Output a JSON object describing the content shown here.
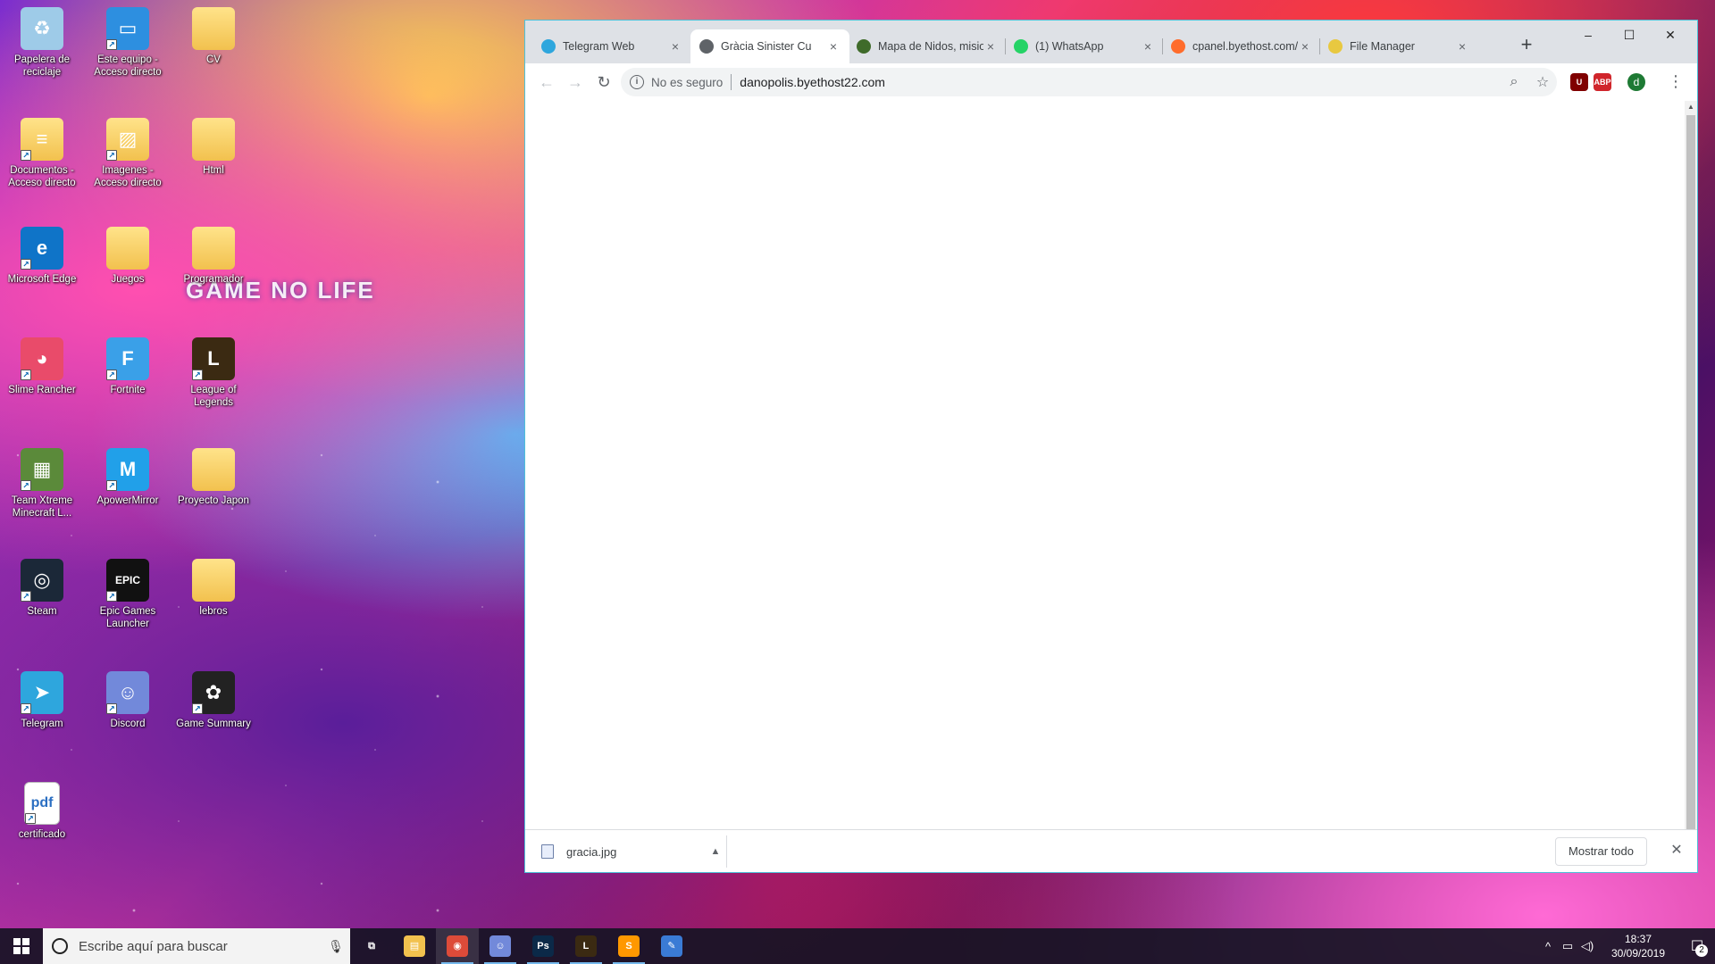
{
  "wallpaper": {
    "title_text": "GAME NO LIFE"
  },
  "desktop_icons": [
    {
      "label": "Papelera de reciclaje",
      "icon": "recycle-bin-icon",
      "glyph": "♻",
      "color": "#9ecbe8"
    },
    {
      "label": "Este equipo - Acceso directo",
      "icon": "computer-icon",
      "glyph": "▭",
      "color": "#2d8fe0"
    },
    {
      "label": "CV",
      "icon": "folder-icon",
      "glyph": "",
      "color": "#f2c14e"
    },
    {
      "label": "Documentos - Acceso directo",
      "icon": "documents-icon",
      "glyph": "≡",
      "color": "#f2c14e"
    },
    {
      "label": "Imagenes - Acceso directo",
      "icon": "pictures-icon",
      "glyph": "▨",
      "color": "#f2c14e"
    },
    {
      "label": "Html",
      "icon": "folder-icon",
      "glyph": "",
      "color": "#f2c14e"
    },
    {
      "label": "Microsoft Edge",
      "icon": "edge-icon",
      "glyph": "e",
      "color": "#0f74c8"
    },
    {
      "label": "Juegos",
      "icon": "folder-icon",
      "glyph": "",
      "color": "#f2c14e"
    },
    {
      "label": "Programador",
      "icon": "folder-icon",
      "glyph": "",
      "color": "#f2c14e"
    },
    {
      "label": "Slime Rancher",
      "icon": "slime-rancher-icon",
      "glyph": "◕",
      "color": "#e94b6a"
    },
    {
      "label": "Fortnite",
      "icon": "fortnite-icon",
      "glyph": "F",
      "color": "#3aa0e8"
    },
    {
      "label": "League of Legends",
      "icon": "league-of-legends-icon",
      "glyph": "L",
      "color": "#3b2a12"
    },
    {
      "label": "Team Xtreme Minecraft L...",
      "icon": "minecraft-icon",
      "glyph": "▦",
      "color": "#5b8a3a"
    },
    {
      "label": "ApowerMirror",
      "icon": "apowermirror-icon",
      "glyph": "M",
      "color": "#21a0e9"
    },
    {
      "label": "Proyecto Japon",
      "icon": "folder-icon",
      "glyph": "",
      "color": "#f2c14e"
    },
    {
      "label": "Steam",
      "icon": "steam-icon",
      "glyph": "◎",
      "color": "#1b2838"
    },
    {
      "label": "Epic Games Launcher",
      "icon": "epic-games-icon",
      "glyph": "EPIC",
      "color": "#111111"
    },
    {
      "label": "lebros",
      "icon": "folder-icon",
      "glyph": "",
      "color": "#f2c14e"
    },
    {
      "label": "Telegram",
      "icon": "telegram-icon",
      "glyph": "➤",
      "color": "#2ea6dd"
    },
    {
      "label": "Discord",
      "icon": "discord-icon",
      "glyph": "☺",
      "color": "#7289da"
    },
    {
      "label": "Game Summary",
      "icon": "game-summary-icon",
      "glyph": "✿",
      "color": "#222222"
    },
    {
      "label": "certificado",
      "icon": "pdf-icon",
      "glyph": "pdf",
      "color": "#ffffff"
    }
  ],
  "browser": {
    "tabs": [
      {
        "title": "Telegram Web",
        "icon": "telegram-tab-icon",
        "color": "#2ea6dd",
        "active": false
      },
      {
        "title": "Gràcia Sinister Cu",
        "icon": "globe-tab-icon",
        "color": "#5f6368",
        "active": true
      },
      {
        "title": "Mapa de Nidos, misio",
        "icon": "map-tab-icon",
        "color": "#3f6b2a",
        "active": false
      },
      {
        "title": "(1) WhatsApp",
        "icon": "whatsapp-tab-icon",
        "color": "#25d366",
        "active": false
      },
      {
        "title": "cpanel.byethost.com/",
        "icon": "cpanel-tab-icon",
        "color": "#ff6c2c",
        "active": false
      },
      {
        "title": "File Manager",
        "icon": "file-manager-tab-icon",
        "color": "#e8c840",
        "active": false
      }
    ],
    "new_tab": "+",
    "window_controls": {
      "minimize": "–",
      "maximize": "☐",
      "close": "✕"
    },
    "omnibox": {
      "security_label": "No es seguro",
      "url": "danopolis.byethost22.com"
    },
    "extensions": [
      {
        "name": "ublock",
        "label": "U",
        "color": "#800000"
      },
      {
        "name": "adblock-plus",
        "label": "ABP",
        "color": "#d0252b"
      }
    ],
    "profile_initial": "d",
    "download": {
      "file_name": "gracia.jpg",
      "show_all": "Mostrar todo"
    }
  },
  "taskbar": {
    "search_placeholder": "Escribe aquí para buscar",
    "apps": [
      {
        "name": "task-view",
        "glyph": "⧉",
        "color": "transparent"
      },
      {
        "name": "file-explorer",
        "glyph": "▤",
        "color": "#f2c14e"
      },
      {
        "name": "chrome",
        "glyph": "◉",
        "color": "#dd4b39"
      },
      {
        "name": "discord",
        "glyph": "☺",
        "color": "#7289da"
      },
      {
        "name": "photoshop",
        "glyph": "Ps",
        "color": "#0b2948"
      },
      {
        "name": "league-of-legends",
        "glyph": "L",
        "color": "#3b2a12"
      },
      {
        "name": "sublime-text",
        "glyph": "S",
        "color": "#ff9800"
      },
      {
        "name": "paint",
        "glyph": "✎",
        "color": "#3a7bd5"
      }
    ],
    "time": "18:37",
    "date": "30/09/2019",
    "notification_count": "2"
  }
}
